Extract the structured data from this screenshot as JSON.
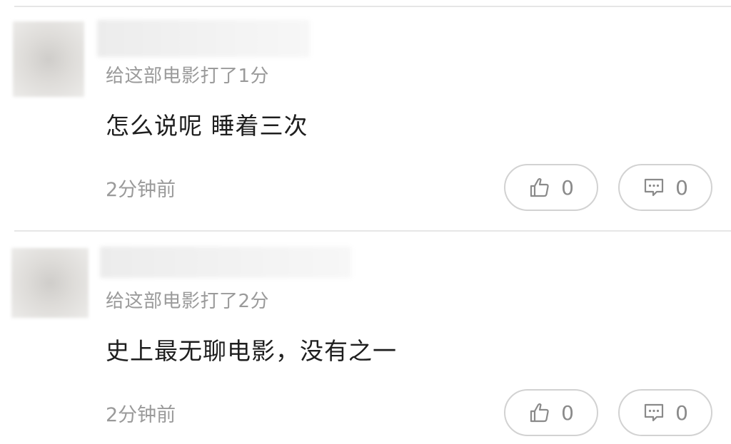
{
  "comments": [
    {
      "rating_text": "给这部电影打了1分",
      "content": "怎么说呢 睡着三次",
      "time": "2分钟前",
      "likes": "0",
      "replies": "0"
    },
    {
      "rating_text": "给这部电影打了2分",
      "content": "史上最无聊电影，没有之一",
      "time": "2分钟前",
      "likes": "0",
      "replies": "0"
    }
  ],
  "icons": {
    "like": "thumbs-up-icon",
    "reply": "comment-bubble-icon"
  },
  "colors": {
    "secondary_text": "#9a9a9a",
    "primary_text": "#1e1e1e",
    "pill_border": "#d2d2d2",
    "divider": "#e6e6e6"
  }
}
